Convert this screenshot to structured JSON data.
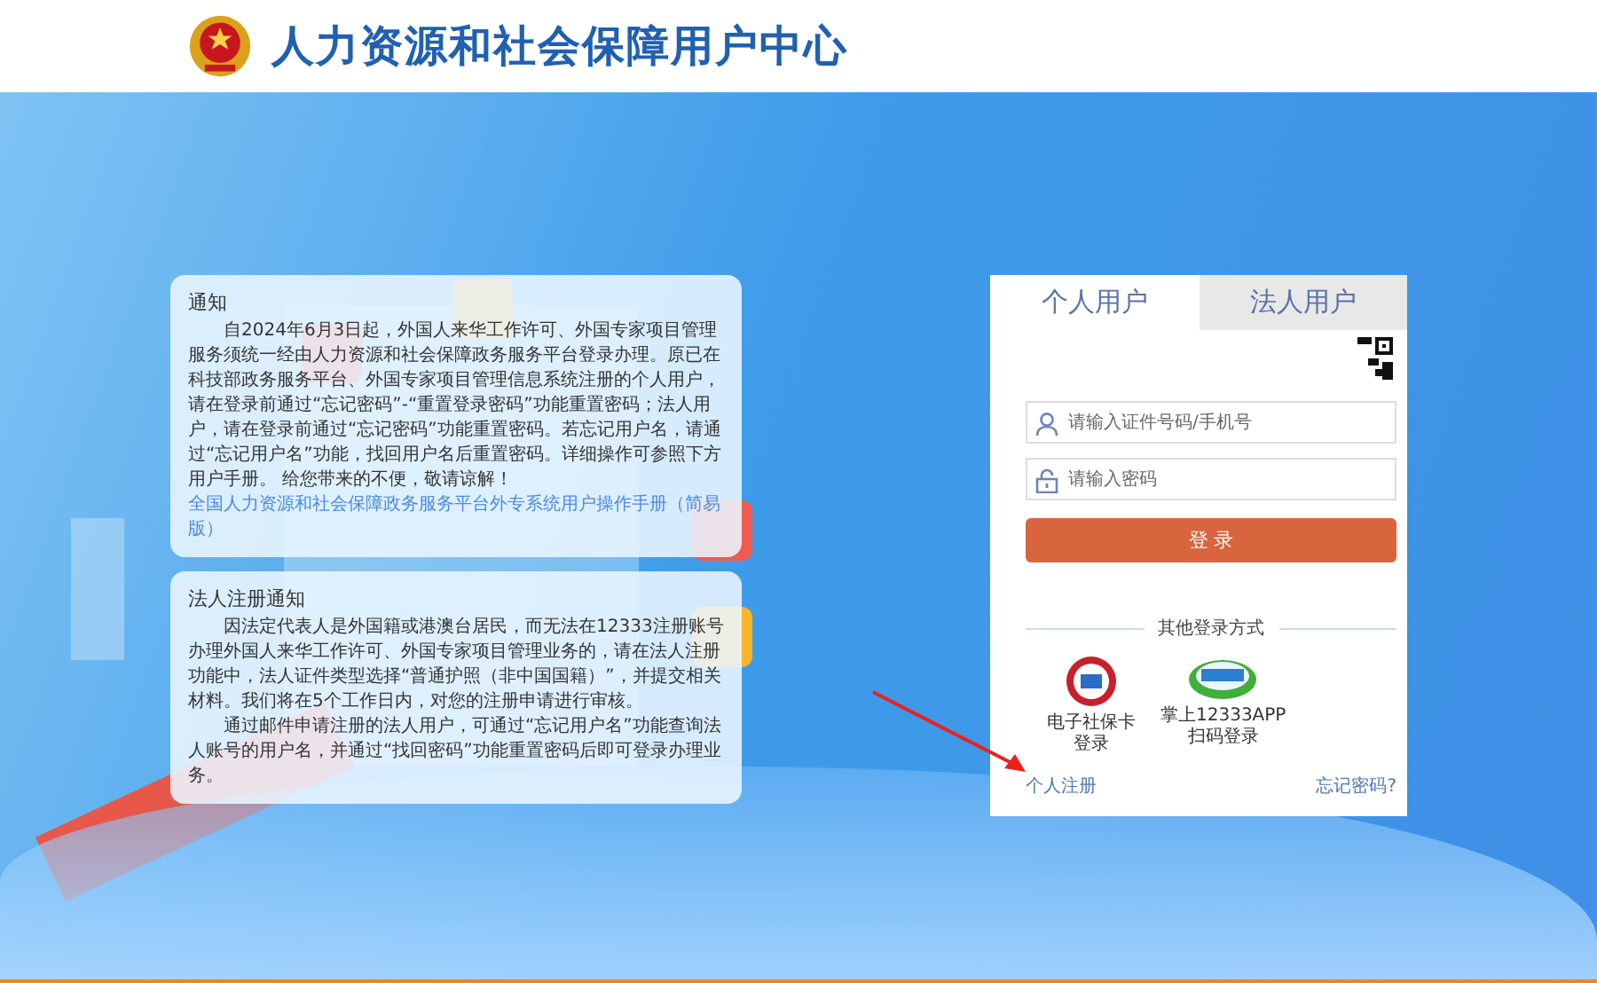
{
  "header": {
    "title": "人力资源和社会保障用户中心"
  },
  "notices": [
    {
      "title": "通知",
      "paragraphs": [
        "自2024年6月3日起，外国人来华工作许可、外国专家项目管理服务须统一经由人力资源和社会保障政务服务平台登录办理。原已在科技部政务服务平台、外国专家项目管理信息系统注册的个人用户，请在登录前通过“忘记密码”-“重置登录密码”功能重置密码；法人用户，请在登录前通过“忘记密码”功能重置密码。若忘记用户名，请通过“忘记用户名”功能，找回用户名后重置密码。详细操作可参照下方用户手册。 给您带来的不便，敬请谅解！"
      ],
      "link": "全国人力资源和社会保障政务服务平台外专系统用户操作手册（简易版）"
    },
    {
      "title": "法人注册通知",
      "paragraphs": [
        "因法定代表人是外国籍或港澳台居民，而无法在12333注册账号办理外国人来华工作许可、外国专家项目管理业务的，请在法人注册功能中，法人证件类型选择“普通护照（非中国国籍）”，并提交相关材料。我们将在5个工作日内，对您的注册申请进行审核。",
        "通过邮件申请注册的法人用户，可通过“忘记用户名”功能查询法人账号的用户名，并通过“找回密码”功能重置密码后即可登录办理业务。"
      ]
    }
  ],
  "login": {
    "tabs": [
      {
        "label": "个人用户",
        "selected": true
      },
      {
        "label": "法人用户",
        "selected": false
      }
    ],
    "fields": [
      {
        "kind": "user",
        "placeholder": "请输入证件号码/手机号"
      },
      {
        "kind": "lock",
        "placeholder": "请输入密码"
      }
    ],
    "button": "登 录",
    "other_title": "其他登录方式",
    "other_methods": [
      {
        "kind": "card",
        "lines": [
          "电子社保卡",
          "登录"
        ]
      },
      {
        "kind": "app",
        "lines": [
          "掌上12333APP",
          "扫码登录"
        ]
      }
    ],
    "register": "个人注册",
    "forgot": "忘记密码?"
  }
}
